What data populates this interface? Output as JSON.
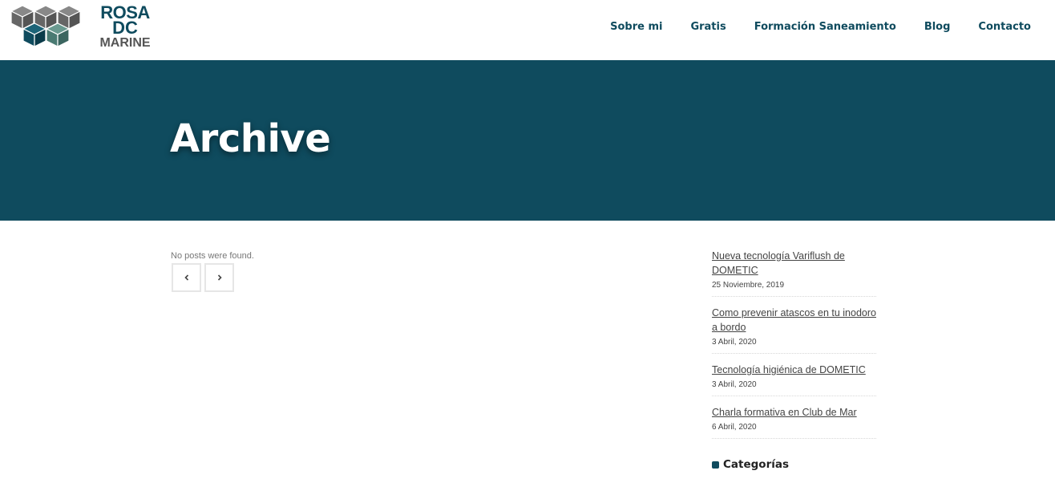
{
  "brand": {
    "line1": "ROSA",
    "line2": "DC",
    "line3": "MARINE",
    "colors": {
      "primary": "#0f4b5e",
      "cube_gray": "#666666",
      "cube_teal": "#4a7a72"
    }
  },
  "nav": {
    "items": [
      {
        "label": "Sobre mi"
      },
      {
        "label": "Gratis"
      },
      {
        "label": "Formación Saneamiento"
      },
      {
        "label": "Blog"
      },
      {
        "label": "Contacto"
      }
    ]
  },
  "hero": {
    "title": "Archive"
  },
  "main": {
    "empty_message": "No posts were found.",
    "pager": {
      "prev_icon": "chevron-left-icon",
      "next_icon": "chevron-right-icon"
    }
  },
  "sidebar": {
    "posts": [
      {
        "title": "Nueva tecnología Variflush de DOMETIC",
        "date": "25 Noviembre, 2019"
      },
      {
        "title": "Como prevenir atascos en tu inodoro a bordo",
        "date": "3 Abril, 2020"
      },
      {
        "title": "Tecnología higiénica de DOMETIC",
        "date": "3 Abril, 2020"
      },
      {
        "title": "Charla formativa en Club de Mar",
        "date": "6 Abril, 2020"
      }
    ],
    "categories_heading": "Categorías"
  }
}
